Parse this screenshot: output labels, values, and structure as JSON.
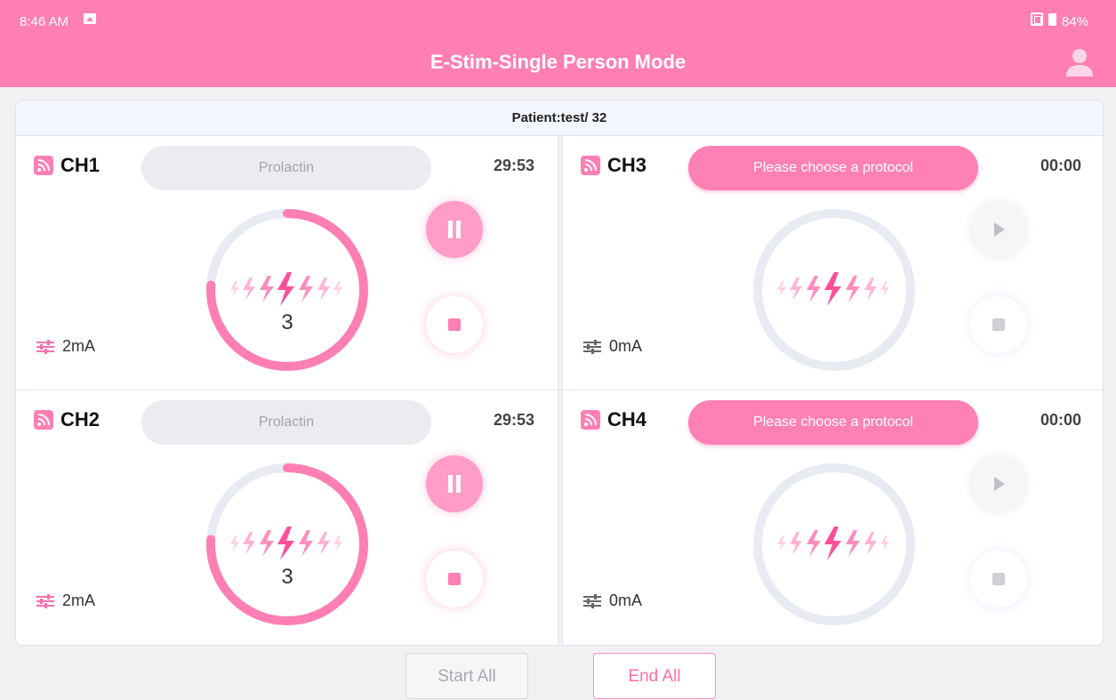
{
  "status_bar": {
    "time": "8:46 AM",
    "battery": "84%"
  },
  "title": "E-Stim-Single Person Mode",
  "patient": "Patient:test/ 32",
  "colors": {
    "accent": "#ff7fb4",
    "inactive": "#ebecf0",
    "ring_track": "#e8ebf2"
  },
  "channels": [
    {
      "label": "CH1",
      "protocol": "Prolactin",
      "timer": "29:53",
      "level": "3",
      "intensity": "2mA",
      "progress": 0.76,
      "running": true
    },
    {
      "label": "CH3",
      "protocol": "Please choose a protocol",
      "timer": "00:00",
      "level": "",
      "intensity": "0mA",
      "progress": 0,
      "running": false
    },
    {
      "label": "CH2",
      "protocol": "Prolactin",
      "timer": "29:53",
      "level": "3",
      "intensity": "2mA",
      "progress": 0.76,
      "running": true
    },
    {
      "label": "CH4",
      "protocol": "Please choose a protocol",
      "timer": "00:00",
      "level": "",
      "intensity": "0mA",
      "progress": 0,
      "running": false
    }
  ],
  "footer": {
    "start_all": "Start All",
    "end_all": "End All"
  }
}
